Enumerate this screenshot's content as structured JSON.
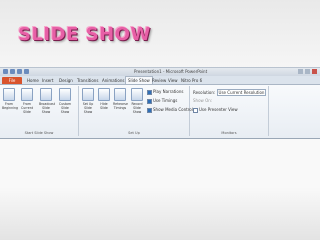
{
  "slide_title": "SLIDE SHOW",
  "window": {
    "title": "Presentation1 - Microsoft PowerPoint"
  },
  "tabs": [
    "File",
    "Home",
    "Insert",
    "Design",
    "Transitions",
    "Animations",
    "Slide Show",
    "Review",
    "View",
    "Nitro Pro 6"
  ],
  "active_tab": "Slide Show",
  "groups": {
    "start": {
      "label": "Start Slide Show",
      "buttons": [
        "From Beginning",
        "From Current Slide",
        "Broadcast Slide Show",
        "Custom Slide Show"
      ]
    },
    "setup": {
      "label": "Set Up",
      "buttons": [
        "Set Up Slide Show",
        "Hide Slide",
        "Rehearse Timings",
        "Record Slide Show"
      ],
      "checks": [
        {
          "label": "Play Narrations",
          "checked": true
        },
        {
          "label": "Use Timings",
          "checked": true
        },
        {
          "label": "Show Media Controls",
          "checked": true
        }
      ]
    },
    "monitors": {
      "label": "Monitors",
      "resolution_label": "Resolution:",
      "resolution_value": "Use Current Resolution",
      "show_on_label": "Show On:",
      "presenter_label": "Use Presenter View"
    }
  },
  "colors": {
    "title": "#e75fa6",
    "file_tab": "#d9532c"
  }
}
